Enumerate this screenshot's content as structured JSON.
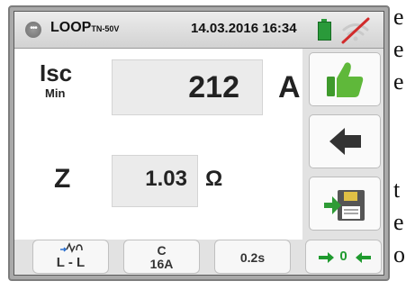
{
  "header": {
    "mode": "LOOP",
    "mode_sub": "TN-50V",
    "datetime": "14.03.2016 16:34"
  },
  "isc": {
    "label": "Isc",
    "sub": "Min",
    "value": "212",
    "unit": "A"
  },
  "z": {
    "label": "Z",
    "value": "1.03",
    "unit": "Ω"
  },
  "sidebar": {
    "icons": [
      "thumbs-up-icon",
      "back-arrow-icon",
      "save-to-memory-icon"
    ]
  },
  "bottom": {
    "phase": "L - L",
    "breaker_curve": "C",
    "breaker_rating": "16A",
    "time": "0.2s",
    "zero": "0"
  },
  "page_edge_text": [
    "e",
    "e",
    "e",
    "t",
    "e",
    "o"
  ],
  "colors": {
    "status_green": "#2a9a3a",
    "panel_bg": "#e2e2e2",
    "no_signal_red": "#d12b2b"
  }
}
